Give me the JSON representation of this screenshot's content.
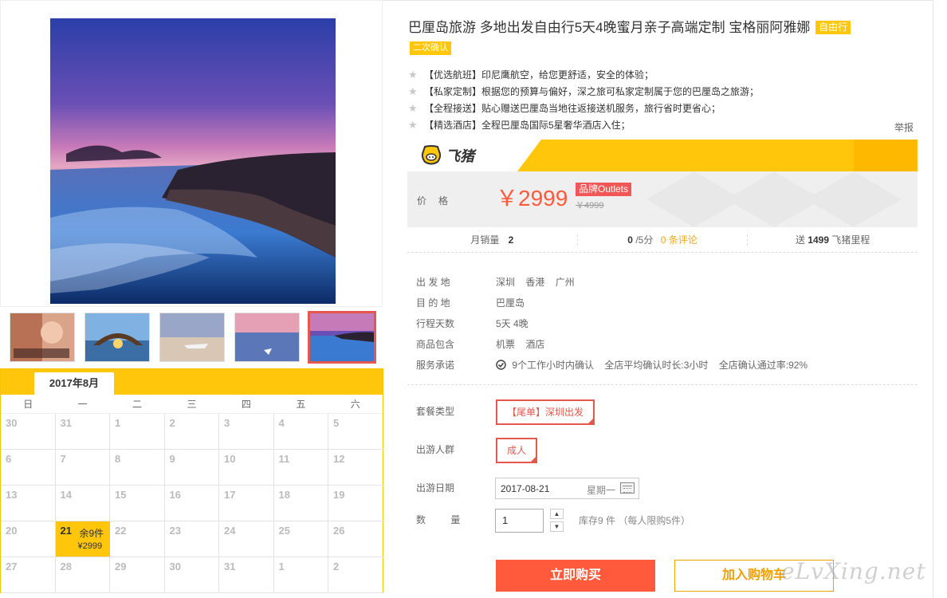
{
  "product": {
    "title": "巴厘岛旅游 多地出发自由行5天4晚蜜月亲子高端定制 宝格丽阿雅娜",
    "tag_type": "自由行",
    "tag_confirm": "二次确认",
    "features": [
      "【优选航班】印尼鹰航空，给您更舒适，安全的体验；",
      "【私家定制】根据您的预算与偏好，深之旅可私家定制属于您的巴厘岛之旅游；",
      "【全程接送】贴心赠送巴厘岛当地往返接送机服务，旅行省时更省心；",
      "【精选酒店】全程巴厘岛国际5星奢华酒店入住；"
    ],
    "report_label": "举报"
  },
  "brand": {
    "name": "飞猪"
  },
  "price": {
    "label": "价格",
    "current": "￥2999",
    "badge": "品牌Outlets",
    "original": "￥4999"
  },
  "stats": {
    "sales_label": "月销量",
    "sales_value": "2",
    "rating_value": "0",
    "rating_suffix": "/5分",
    "reviews_link": "0 条评论",
    "miles_prefix": "送",
    "miles_value": "1499",
    "miles_suffix": "飞猪里程"
  },
  "info": {
    "departure_label": "出 发 地",
    "departures": [
      "深圳",
      "香港",
      "广州"
    ],
    "destination_label": "目 的 地",
    "destination": "巴厘岛",
    "duration_label": "行程天数",
    "duration": "5天 4晚",
    "includes_label": "商品包含",
    "includes": [
      "机票",
      "酒店"
    ],
    "service_label": "服务承诺",
    "service_items": [
      "9个工作小时内确认",
      "全店平均确认时长:3小时",
      "全店确认通过率:92%"
    ]
  },
  "options": {
    "package_label": "套餐类型",
    "package_value": "【尾单】深圳出发",
    "group_label": "出游人群",
    "group_value": "成人",
    "date_label": "出游日期",
    "date_value": "2017-08-21",
    "date_weekday": "星期一",
    "qty_label": "数 量",
    "qty_value": "1",
    "stock_note": "库存9 件 （每人限购5件）"
  },
  "actions": {
    "buy_now": "立即购买",
    "add_cart": "加入购物车"
  },
  "watermark": "eLvXing.net",
  "calendar": {
    "month": "2017年8月",
    "weekdays": [
      "日",
      "一",
      "二",
      "三",
      "四",
      "五",
      "六"
    ],
    "days": [
      "30",
      "31",
      "1",
      "2",
      "3",
      "4",
      "5",
      "6",
      "7",
      "8",
      "9",
      "10",
      "11",
      "12",
      "13",
      "14",
      "15",
      "16",
      "17",
      "18",
      "19",
      "20",
      "21",
      "22",
      "23",
      "24",
      "25",
      "26",
      "27",
      "28",
      "29",
      "30",
      "31",
      "1",
      "2"
    ],
    "available": {
      "day": "21",
      "stock": "余9件",
      "price": "¥2999"
    }
  }
}
